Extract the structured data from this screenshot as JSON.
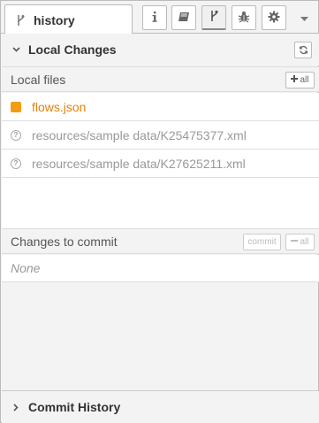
{
  "tabs": {
    "active_label": "history",
    "buttons": [
      {
        "name": "info-tab-button",
        "icon": "info-icon"
      },
      {
        "name": "help-tab-button",
        "icon": "book-icon"
      },
      {
        "name": "history-tab-button",
        "icon": "branch-icon",
        "selected": true
      },
      {
        "name": "debug-tab-button",
        "icon": "bug-icon"
      },
      {
        "name": "config-tab-button",
        "icon": "gear-icon"
      }
    ]
  },
  "local_changes": {
    "title": "Local Changes",
    "local_files": {
      "label": "Local files",
      "all_button": "all",
      "files": [
        {
          "name": "flows.json",
          "status": "modified",
          "color": "#e6800a"
        },
        {
          "name": "resources/sample data/K25475377.xml",
          "status": "untracked"
        },
        {
          "name": "resources/sample data/K27625211.xml",
          "status": "untracked"
        }
      ]
    },
    "commit": {
      "label": "Changes to commit",
      "commit_button": "commit",
      "all_button": "all",
      "empty_text": "None"
    }
  },
  "commit_history": {
    "title": "Commit History"
  },
  "colors": {
    "modified": "#e6800a",
    "muted": "#999999",
    "border": "#bbbbbb"
  }
}
